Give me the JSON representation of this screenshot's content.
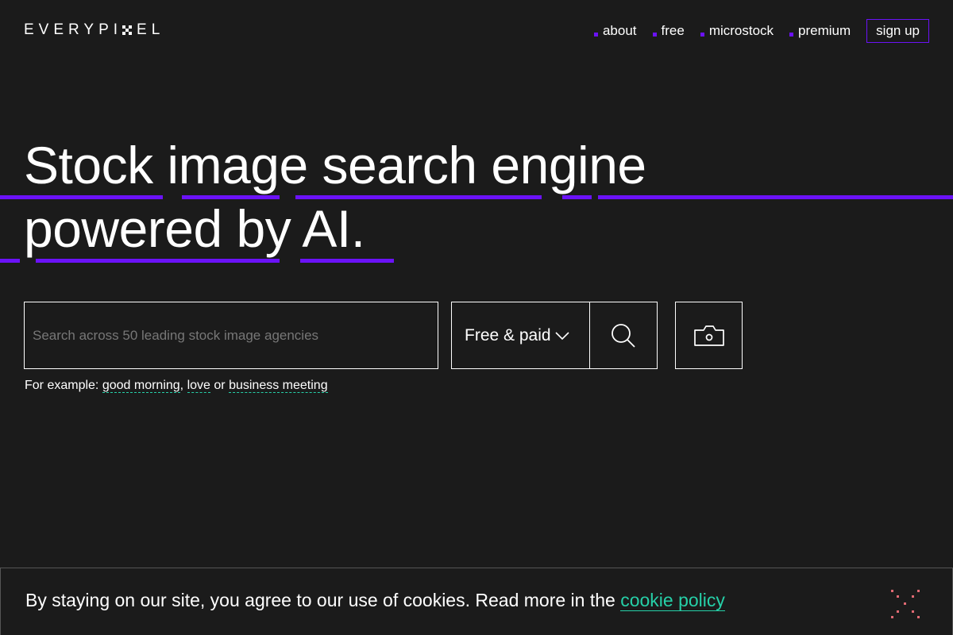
{
  "header": {
    "logo_left": "EVERYPI",
    "logo_right": "EL",
    "nav": [
      {
        "label": "about"
      },
      {
        "label": "free"
      },
      {
        "label": "microstock"
      },
      {
        "label": "premium"
      }
    ],
    "signup_label": "sign up"
  },
  "hero": {
    "line1": "Stock image search engine",
    "line2": "powered by AI."
  },
  "search": {
    "placeholder": "Search across 50 leading stock image agencies",
    "filter_value": "Free & paid",
    "filter_icon": "chevron-down-icon",
    "search_icon": "magnifier-icon",
    "camera_icon": "camera-icon"
  },
  "examples": {
    "prefix": "For example:",
    "link1": "good morning",
    "sep1": ",",
    "link2": "love",
    "sep2": "or",
    "link3": "business meeting"
  },
  "cookie": {
    "text": "By staying on our site, you agree to our use of cookies. Read more in the",
    "link": "cookie policy",
    "close_icon": "close-icon"
  },
  "colors": {
    "background": "#1b1b1b",
    "accent_purple": "#6b12f7",
    "accent_teal": "#26d0a8",
    "close_pink": "#e06a73"
  }
}
